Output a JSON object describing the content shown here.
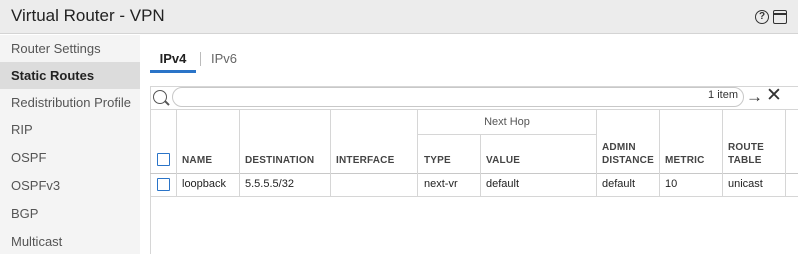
{
  "window": {
    "title": "Virtual Router - VPN",
    "icons": [
      "help-icon",
      "window-icon"
    ]
  },
  "sidebar": {
    "items": [
      {
        "label": "Router Settings",
        "active": false
      },
      {
        "label": "Static Routes",
        "active": true
      },
      {
        "label": "Redistribution Profile",
        "active": false
      },
      {
        "label": "RIP",
        "active": false
      },
      {
        "label": "OSPF",
        "active": false
      },
      {
        "label": "OSPFv3",
        "active": false
      },
      {
        "label": "BGP",
        "active": false
      },
      {
        "label": "Multicast",
        "active": false
      }
    ]
  },
  "tabs": [
    {
      "label": "IPv4",
      "active": true
    },
    {
      "label": "IPv6",
      "active": false
    }
  ],
  "search": {
    "placeholder": "",
    "count": "1 item"
  },
  "table": {
    "group_header": "Next Hop",
    "columns": {
      "name": "NAME",
      "destination": "DESTINATION",
      "interface": "INTERFACE",
      "type": "TYPE",
      "value": "VALUE",
      "admin_distance_1": "ADMIN",
      "admin_distance_2": "DISTANCE",
      "metric": "METRIC",
      "route_table_1": "ROUTE",
      "route_table_2": "TABLE"
    },
    "rows": [
      {
        "name": "loopback",
        "destination": "5.5.5.5/32",
        "interface": "",
        "type": "next-vr",
        "value": "default",
        "admin_distance": "default",
        "metric": "10",
        "route_table": "unicast"
      }
    ]
  },
  "colors": {
    "accent": "#2a74c8",
    "titlebar": "#ececec",
    "sidebar": "#f4f4f4",
    "sidebar_active": "#dcdcdc"
  }
}
